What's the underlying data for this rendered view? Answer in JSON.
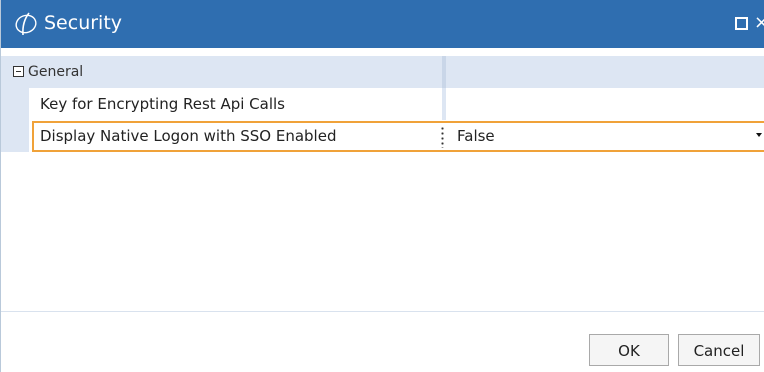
{
  "window": {
    "title": "Security",
    "close_glyph": "×",
    "title_color": "#2f6eb0"
  },
  "grid": {
    "category": {
      "label": "General",
      "expanded": true
    },
    "properties": [
      {
        "name": "Key for Encrypting Rest Api Calls",
        "value": ""
      },
      {
        "name": "Display Native Logon with SSO Enabled",
        "value": "False",
        "selected": true
      }
    ],
    "highlight_color": "#f0a239"
  },
  "buttons": {
    "ok_label": "OK",
    "cancel_label": "Cancel"
  },
  "icons": {
    "logo": "app-logo-icon",
    "maximize": "maximize-icon",
    "close": "close-icon",
    "collapse": "collapse-icon",
    "dropdown": "chevron-down-icon"
  }
}
